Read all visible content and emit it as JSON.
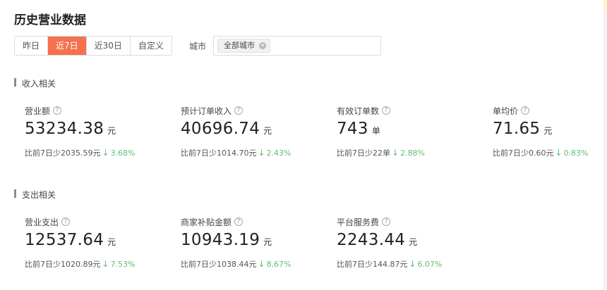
{
  "page": {
    "title": "历史营业数据"
  },
  "filters": {
    "date_options": [
      {
        "label": "昨日",
        "active": false
      },
      {
        "label": "近7日",
        "active": true
      },
      {
        "label": "近30日",
        "active": false
      },
      {
        "label": "自定义",
        "active": false
      }
    ],
    "city_label": "城市",
    "city_tag": "全部城市"
  },
  "sections": [
    {
      "title": "收入相关",
      "metrics": [
        {
          "label": "营业额",
          "value": "53234.38",
          "unit": "元",
          "compare": "比前7日少2035.59元",
          "change": "3.68%"
        },
        {
          "label": "预计订单收入",
          "value": "40696.74",
          "unit": "元",
          "compare": "比前7日少1014.70元",
          "change": "2.43%"
        },
        {
          "label": "有效订单数",
          "value": "743",
          "unit": "单",
          "compare": "比前7日少22单",
          "change": "2.88%"
        },
        {
          "label": "单均价",
          "value": "71.65",
          "unit": "元",
          "compare": "比前7日少0.60元",
          "change": "0.83%"
        }
      ]
    },
    {
      "title": "支出相关",
      "metrics": [
        {
          "label": "营业支出",
          "value": "12537.64",
          "unit": "元",
          "compare": "比前7日少1020.89元",
          "change": "7.53%"
        },
        {
          "label": "商家补贴金额",
          "value": "10943.19",
          "unit": "元",
          "compare": "比前7日少1038.44元",
          "change": "8.67%"
        },
        {
          "label": "平台服务费",
          "value": "2243.44",
          "unit": "元",
          "compare": "比前7日少144.87元",
          "change": "6.07%"
        }
      ]
    }
  ],
  "icons": {
    "help": "question-circle-icon",
    "close": "close-circle-icon",
    "trend": "arrow-down-icon"
  },
  "colors": {
    "accent": "#f5714f",
    "decrease": "#5fbf6f"
  }
}
